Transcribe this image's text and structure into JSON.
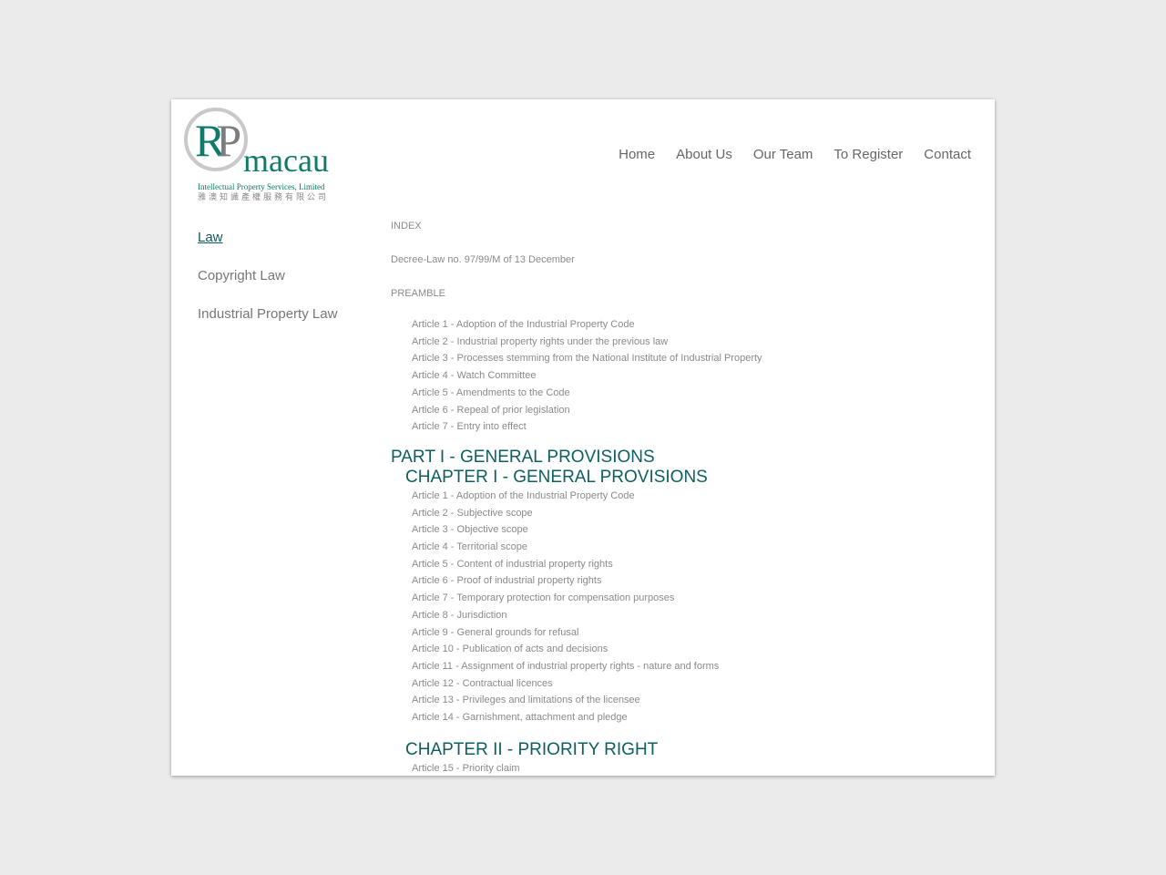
{
  "logo": {
    "mark_r": "R",
    "mark_p": "P",
    "word": "macau",
    "subtitle_en": "Intellectual Property Services, Limited",
    "subtitle_zh": "雅澳知識產權服務有限公司"
  },
  "nav": [
    "Home",
    "About Us",
    "Our Team",
    "To Register",
    "Contact"
  ],
  "sidebar": [
    "Law",
    "Copyright Law",
    "Industrial Property Law"
  ],
  "content": {
    "index": "INDEX",
    "decree": "Decree-Law no. 97/99/M of 13 December",
    "preamble": "PREAMBLE",
    "preamble_articles": [
      "Article 1 - Adoption of the Industrial Property Code",
      "Article 2 - Industrial property rights under the previous law",
      "Article 3 - Processes stemming from the National Institute of Industrial Property",
      "Article 4 - Watch Committee",
      "Article 5 - Amendments to the Code",
      "Article 6 - Repeal of prior legislation",
      "Article 7 - Entry into effect"
    ],
    "part1": "PART I - GENERAL PROVISIONS",
    "chapter1": "CHAPTER I - GENERAL PROVISIONS",
    "chapter1_articles": [
      "Article 1 - Adoption of the Industrial Property Code",
      "Article 2 - Subjective scope",
      "Article 3 - Objective scope",
      "Article 4 - Territorial scope",
      "Article 5 - Content of industrial property rights",
      "Article 6 - Proof of industrial property rights",
      "Article 7 - Temporary protection for compensation purposes",
      "Article 8 - Jurisdiction",
      "Article 9 - General grounds for refusal",
      "Article 10 - Publication of acts and decisions",
      "Article 11 - Assignment of industrial property rights - nature and forms",
      "Article 12 - Contractual licences",
      "Article 13 - Privileges and limitations of the licensee",
      "Article 14 - Garnishment, attachment and pledge"
    ],
    "chapter2": "CHAPTER II - PRIORITY RIGHT",
    "chapter2_articles": [
      "Article 15 - Priority claim"
    ]
  }
}
